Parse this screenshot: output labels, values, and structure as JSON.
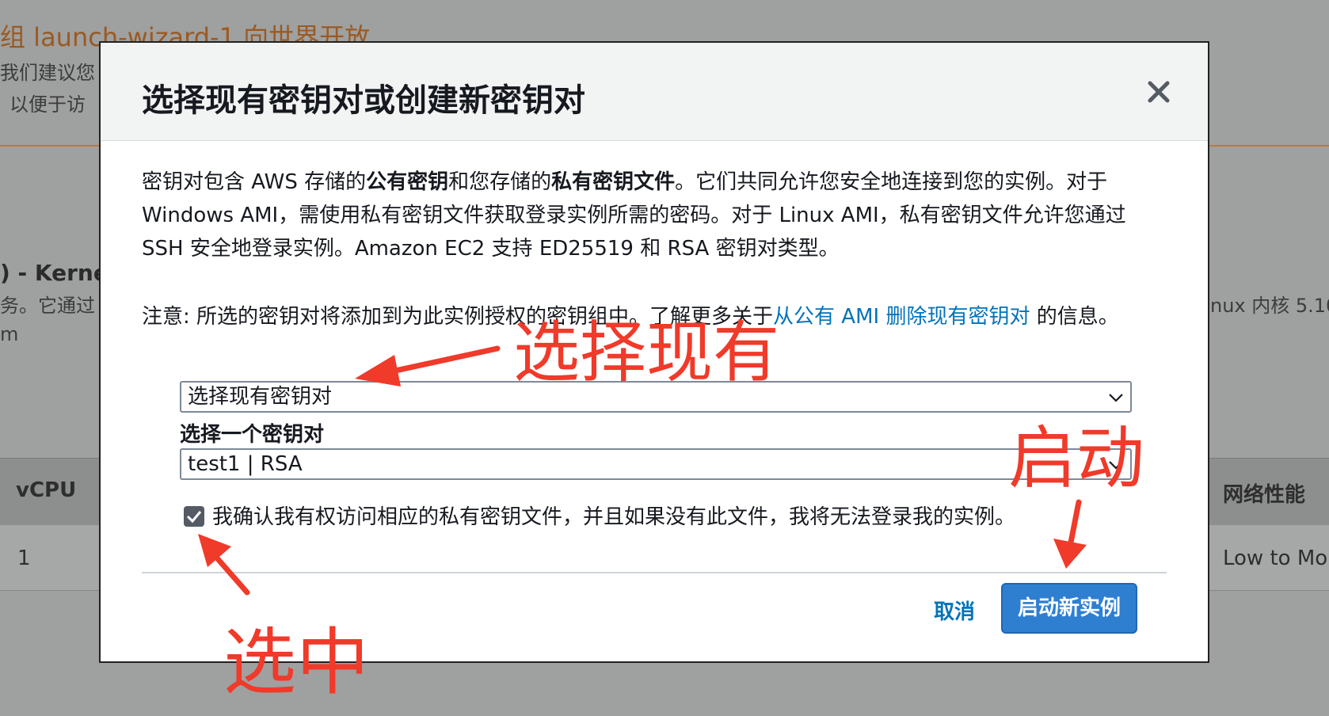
{
  "background": {
    "section_title": "组 launch-wizard-1 向世界开放",
    "line_1": "我们建议您",
    "line_2": "以便于访",
    "kernel_heading": ") - Kerne",
    "desc_left": "务。它通过",
    "desc_right": "nux 内核 5.10",
    "desc_m": "m",
    "table_header_vcpu": "vCPU",
    "table_header_network": "网络性能",
    "table_cell_vcpu": "1",
    "table_cell_network": "Low to Mo"
  },
  "modal": {
    "title": "选择现有密钥对或创建新密钥对",
    "description_1_a": "密钥对包含 AWS 存储的",
    "description_1_b": "公有密钥",
    "description_1_c": "和您存储的",
    "description_1_d": "私有密钥文件",
    "description_1_e": "。它们共同允许您安全地连接到您的实例。对于 Windows AMI，需使用私有密钥文件获取登录实例所需的密码。对于 Linux AMI，私有密钥文件允许您通过 SSH 安全地登录实例。Amazon EC2 支持 ED25519 和 RSA 密钥对类型。",
    "note_prefix": "注意: 所选的密钥对将添加到为此实例授权的密钥组中。了解更多关于",
    "note_link": "从公有 AMI 删除现有密钥对",
    "note_suffix": "的信息。",
    "keypair_action_select": "选择现有密钥对",
    "keypair_label": "选择一个密钥对",
    "keypair_value": "test1 | RSA",
    "acknowledge_text": "我确认我有权访问相应的私有密钥文件，并且如果没有此文件，我将无法登录我的实例。",
    "acknowledge_checked": true,
    "cancel_label": "取消",
    "launch_label": "启动新实例"
  },
  "annotations": {
    "select_existing": "选择现有",
    "launch": "启动",
    "check": "选中",
    "color": "#f03a2a"
  }
}
